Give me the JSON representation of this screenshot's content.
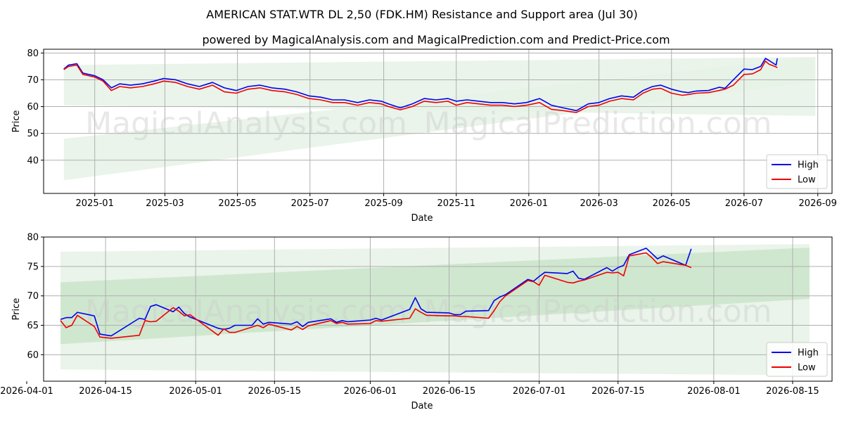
{
  "title": "AMERICAN STAT.WTR DL 2,50 (FDK.HM) Resistance and Support area (Jul 30)",
  "subtitle": "powered by MagicalAnalysis.com and MagicalPrediction.com and Predict-Price.com",
  "watermark_left": "MagicalAnalysis.com",
  "watermark_right": "MagicalPrediction.com",
  "colors": {
    "high": "#0000ee",
    "low": "#ee0000",
    "band_dark": "#c8e3c8",
    "band_light": "#e6f2e6",
    "grid": "#b0b0b0"
  },
  "chart_data": [
    {
      "type": "line",
      "xlabel": "Date",
      "ylabel": "Price",
      "x_range": [
        "2024-11-19",
        "2026-09-13"
      ],
      "ylim": [
        27.6,
        81.4
      ],
      "xticks": [
        "2025-01-01",
        "2025-03-01",
        "2025-05-01",
        "2025-07-01",
        "2025-09-01",
        "2025-11-01",
        "2026-01-01",
        "2026-03-01",
        "2026-05-01",
        "2026-07-01",
        "2026-09-01"
      ],
      "xtick_labels": [
        "2025-01",
        "2025-03",
        "2025-05",
        "2025-07",
        "2025-09",
        "2025-11",
        "2026-01",
        "2026-03",
        "2026-05",
        "2026-07",
        "2026-09"
      ],
      "yticks": [
        40,
        50,
        60,
        70,
        80
      ],
      "grid": true,
      "legend": "lower right",
      "bands": [
        {
          "x": [
            "2024-12-06",
            "2026-08-30"
          ],
          "upper": [
            75.5,
            78.5
          ],
          "lower": [
            60.5,
            56.5
          ],
          "shade": "light"
        },
        {
          "x": [
            "2024-12-06",
            "2026-08-30"
          ],
          "upper": [
            48.0,
            78.5
          ],
          "lower": [
            32.5,
            69.5
          ],
          "shade": "light"
        }
      ],
      "series": [
        {
          "name": "High",
          "color": "#0000ee",
          "x": [
            "2024-12-06",
            "2024-12-10",
            "2024-12-17",
            "2024-12-22",
            "2025-01-01",
            "2025-01-08",
            "2025-01-15",
            "2025-01-22",
            "2025-01-31",
            "2025-02-10",
            "2025-02-20",
            "2025-02-28",
            "2025-03-10",
            "2025-03-20",
            "2025-03-30",
            "2025-04-10",
            "2025-04-20",
            "2025-04-30",
            "2025-05-10",
            "2025-05-20",
            "2025-05-30",
            "2025-06-10",
            "2025-06-20",
            "2025-06-30",
            "2025-07-10",
            "2025-07-20",
            "2025-07-30",
            "2025-08-10",
            "2025-08-20",
            "2025-08-30",
            "2025-09-05",
            "2025-09-15",
            "2025-09-25",
            "2025-10-05",
            "2025-10-15",
            "2025-10-25",
            "2025-11-01",
            "2025-11-10",
            "2025-11-20",
            "2025-11-30",
            "2025-12-10",
            "2025-12-20",
            "2025-12-30",
            "2026-01-10",
            "2026-01-20",
            "2026-01-30",
            "2026-02-10",
            "2026-02-20",
            "2026-03-01",
            "2026-03-10",
            "2026-03-20",
            "2026-03-30",
            "2026-04-07",
            "2026-04-15",
            "2026-04-22",
            "2026-05-01",
            "2026-05-10",
            "2026-05-15",
            "2026-05-22",
            "2026-06-01",
            "2026-06-10",
            "2026-06-15",
            "2026-06-22",
            "2026-07-01",
            "2026-07-08",
            "2026-07-15",
            "2026-07-19",
            "2026-07-22",
            "2026-07-28",
            "2026-07-29"
          ],
          "values": [
            74,
            75.5,
            76,
            72.5,
            71.5,
            70,
            67,
            68.5,
            68,
            68.5,
            69.5,
            70.5,
            70,
            68.5,
            67.5,
            69,
            67,
            66,
            67.5,
            68,
            67,
            66.5,
            65.5,
            64,
            63.5,
            62.5,
            62.5,
            61.5,
            62.5,
            62,
            61,
            59.5,
            61,
            63,
            62.5,
            63,
            62,
            62.5,
            62,
            61.5,
            61.5,
            61,
            61.5,
            63,
            60.5,
            59.5,
            58.5,
            61,
            61.5,
            63,
            64,
            63.5,
            66,
            67.5,
            68,
            66.5,
            65.5,
            65.2,
            65.8,
            66,
            67.2,
            66.8,
            70,
            74,
            73.8,
            75,
            78,
            77.2,
            75.5,
            78
          ]
        },
        {
          "name": "Low",
          "color": "#ee0000",
          "x": [
            "2024-12-06",
            "2024-12-10",
            "2024-12-17",
            "2024-12-22",
            "2025-01-01",
            "2025-01-08",
            "2025-01-15",
            "2025-01-22",
            "2025-01-31",
            "2025-02-10",
            "2025-02-20",
            "2025-02-28",
            "2025-03-10",
            "2025-03-20",
            "2025-03-30",
            "2025-04-10",
            "2025-04-20",
            "2025-04-30",
            "2025-05-10",
            "2025-05-20",
            "2025-05-30",
            "2025-06-10",
            "2025-06-20",
            "2025-06-30",
            "2025-07-10",
            "2025-07-20",
            "2025-07-30",
            "2025-08-10",
            "2025-08-20",
            "2025-08-30",
            "2025-09-05",
            "2025-09-15",
            "2025-09-25",
            "2025-10-05",
            "2025-10-15",
            "2025-10-25",
            "2025-11-01",
            "2025-11-10",
            "2025-11-20",
            "2025-11-30",
            "2025-12-10",
            "2025-12-20",
            "2025-12-30",
            "2026-01-10",
            "2026-01-20",
            "2026-01-30",
            "2026-02-10",
            "2026-02-20",
            "2026-03-01",
            "2026-03-10",
            "2026-03-20",
            "2026-03-30",
            "2026-04-07",
            "2026-04-15",
            "2026-04-22",
            "2026-05-01",
            "2026-05-10",
            "2026-05-15",
            "2026-05-22",
            "2026-06-01",
            "2026-06-10",
            "2026-06-15",
            "2026-06-22",
            "2026-07-01",
            "2026-07-08",
            "2026-07-15",
            "2026-07-19",
            "2026-07-22",
            "2026-07-28",
            "2026-07-29"
          ],
          "values": [
            73.8,
            75,
            75.5,
            72,
            71,
            69.5,
            66,
            67.5,
            67,
            67.5,
            68.5,
            69.5,
            69,
            67.5,
            66.5,
            68,
            65.5,
            65,
            66.5,
            67,
            66,
            65.5,
            64.5,
            63,
            62.5,
            61.5,
            61.5,
            60.5,
            61.5,
            61,
            60,
            58.8,
            60,
            62,
            61.5,
            62,
            60.5,
            61.5,
            61,
            60.5,
            60.5,
            60,
            60.5,
            61.5,
            59,
            58.5,
            57.8,
            60,
            60.5,
            62,
            63,
            62.5,
            65,
            66.5,
            66.8,
            65,
            64.2,
            64.5,
            65,
            65.2,
            66,
            66.5,
            68,
            72,
            72.2,
            73.8,
            77,
            75.8,
            74.8,
            74.5
          ]
        }
      ]
    },
    {
      "type": "line",
      "xlabel": "Date",
      "ylabel": "Price",
      "x_range": [
        "2026-04-04",
        "2026-08-22"
      ],
      "ylim": [
        55.5,
        80.0
      ],
      "xticks": [
        "2026-04-01",
        "2026-04-15",
        "2026-05-01",
        "2026-05-15",
        "2026-06-01",
        "2026-06-15",
        "2026-07-01",
        "2026-07-15",
        "2026-08-01",
        "2026-08-15"
      ],
      "xtick_labels": [
        "2026-04-01",
        "2026-04-15",
        "2026-05-01",
        "2026-05-15",
        "2026-06-01",
        "2026-06-15",
        "2026-07-01",
        "2026-07-15",
        "2026-08-01",
        "2026-08-15"
      ],
      "yticks": [
        60,
        65,
        70,
        75,
        80
      ],
      "grid": true,
      "legend": "lower right",
      "bands": [
        {
          "x": [
            "2026-04-07",
            "2026-08-18"
          ],
          "upper": [
            77.5,
            78.8
          ],
          "lower": [
            57.5,
            56.5
          ],
          "shade": "light"
        },
        {
          "x": [
            "2026-04-07",
            "2026-08-18"
          ],
          "upper": [
            72.3,
            78.2
          ],
          "lower": [
            61.8,
            69.5
          ],
          "shade": "dark"
        }
      ],
      "series": [
        {
          "name": "High",
          "color": "#0000ee",
          "x": [
            "2026-04-07",
            "2026-04-08",
            "2026-04-09",
            "2026-04-10",
            "2026-04-13",
            "2026-04-14",
            "2026-04-16",
            "2026-04-21",
            "2026-04-22",
            "2026-04-23",
            "2026-04-24",
            "2026-04-27",
            "2026-04-28",
            "2026-04-29",
            "2026-04-30",
            "2026-05-05",
            "2026-05-06",
            "2026-05-07",
            "2026-05-08",
            "2026-05-11",
            "2026-05-12",
            "2026-05-13",
            "2026-05-14",
            "2026-05-18",
            "2026-05-19",
            "2026-05-20",
            "2026-05-21",
            "2026-05-25",
            "2026-05-26",
            "2026-05-27",
            "2026-05-28",
            "2026-06-01",
            "2026-06-02",
            "2026-06-03",
            "2026-06-08",
            "2026-06-09",
            "2026-06-10",
            "2026-06-11",
            "2026-06-15",
            "2026-06-16",
            "2026-06-17",
            "2026-06-18",
            "2026-06-22",
            "2026-06-23",
            "2026-06-24",
            "2026-06-25",
            "2026-06-29",
            "2026-06-30",
            "2026-07-01",
            "2026-07-02",
            "2026-07-06",
            "2026-07-07",
            "2026-07-08",
            "2026-07-09",
            "2026-07-13",
            "2026-07-14",
            "2026-07-15",
            "2026-07-16",
            "2026-07-17",
            "2026-07-20",
            "2026-07-21",
            "2026-07-22",
            "2026-07-23",
            "2026-07-27",
            "2026-07-28"
          ],
          "values": [
            66,
            66.3,
            66.3,
            67.2,
            66.6,
            63.5,
            63.2,
            66.2,
            66,
            68.2,
            68.5,
            67.3,
            68.1,
            67,
            66.4,
            64.5,
            64.3,
            64.5,
            65,
            65,
            66.1,
            65.2,
            65.5,
            65.2,
            65.6,
            64.8,
            65.5,
            66.1,
            65.5,
            65.8,
            65.6,
            65.9,
            66.2,
            65.9,
            67.7,
            69.7,
            67.8,
            67.2,
            67.1,
            66.8,
            66.8,
            67.4,
            67.5,
            69.2,
            69.8,
            70.2,
            72.8,
            72.5,
            73.3,
            74,
            73.8,
            74.2,
            73,
            72.8,
            74.8,
            74.2,
            74.8,
            75.2,
            77,
            78.1,
            77.2,
            76.3,
            76.8,
            75.2,
            78
          ]
        },
        {
          "name": "Low",
          "color": "#ee0000",
          "x": [
            "2026-04-07",
            "2026-04-08",
            "2026-04-09",
            "2026-04-10",
            "2026-04-13",
            "2026-04-14",
            "2026-04-16",
            "2026-04-21",
            "2026-04-22",
            "2026-04-23",
            "2026-04-24",
            "2026-04-27",
            "2026-04-28",
            "2026-04-29",
            "2026-04-30",
            "2026-05-05",
            "2026-05-06",
            "2026-05-07",
            "2026-05-08",
            "2026-05-11",
            "2026-05-12",
            "2026-05-13",
            "2026-05-14",
            "2026-05-18",
            "2026-05-19",
            "2026-05-20",
            "2026-05-21",
            "2026-05-25",
            "2026-05-26",
            "2026-05-27",
            "2026-05-28",
            "2026-06-01",
            "2026-06-02",
            "2026-06-03",
            "2026-06-08",
            "2026-06-09",
            "2026-06-10",
            "2026-06-11",
            "2026-06-15",
            "2026-06-16",
            "2026-06-17",
            "2026-06-18",
            "2026-06-22",
            "2026-06-23",
            "2026-06-24",
            "2026-06-25",
            "2026-06-29",
            "2026-06-30",
            "2026-07-01",
            "2026-07-02",
            "2026-07-06",
            "2026-07-07",
            "2026-07-08",
            "2026-07-09",
            "2026-07-13",
            "2026-07-14",
            "2026-07-15",
            "2026-07-16",
            "2026-07-17",
            "2026-07-20",
            "2026-07-21",
            "2026-07-22",
            "2026-07-23",
            "2026-07-27",
            "2026-07-28"
          ],
          "values": [
            65.8,
            64.6,
            65,
            66.7,
            64.8,
            63,
            62.8,
            63.3,
            65.8,
            65.6,
            65.7,
            68,
            67.4,
            66.6,
            66.8,
            63.3,
            64.4,
            63.8,
            63.8,
            64.7,
            65,
            64.6,
            65.2,
            64.2,
            64.8,
            64.3,
            64.9,
            65.8,
            65.3,
            65.5,
            65.2,
            65.3,
            65.8,
            65.7,
            66.2,
            67.8,
            67.2,
            66.7,
            66.6,
            66.6,
            66.5,
            66.5,
            66.2,
            67.5,
            69,
            70,
            72.6,
            72.4,
            71.8,
            73.5,
            72.3,
            72.2,
            72.5,
            72.7,
            74,
            73.9,
            74,
            73.4,
            76.8,
            77.3,
            76.5,
            75.5,
            75.8,
            75.2,
            74.8
          ]
        }
      ]
    }
  ]
}
